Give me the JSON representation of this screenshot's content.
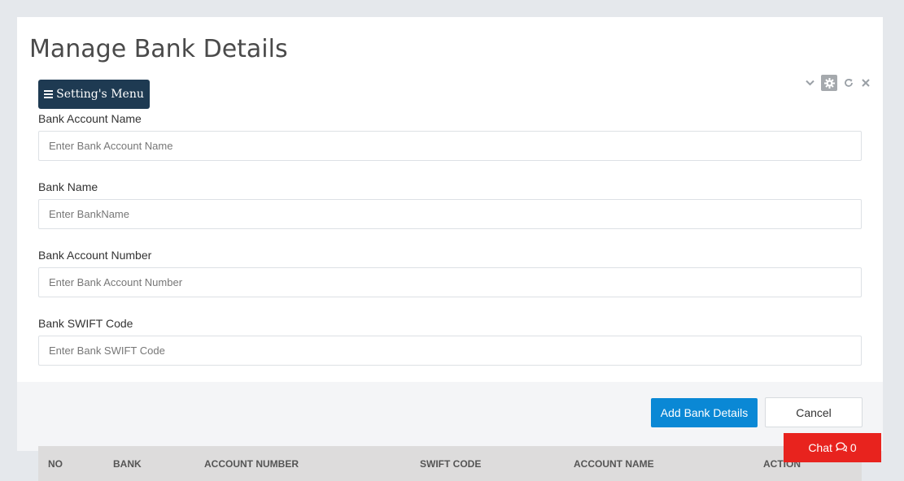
{
  "page": {
    "title": "Manage Bank Details"
  },
  "toolbar": {
    "menu_label": "Setting's Menu",
    "icons": [
      "chevron-down-icon",
      "gear-icon",
      "refresh-icon",
      "close-icon"
    ]
  },
  "form": {
    "fields": [
      {
        "label": "Bank Account Name",
        "placeholder": "Enter Bank Account Name",
        "value": ""
      },
      {
        "label": "Bank Name",
        "placeholder": "Enter BankName",
        "value": ""
      },
      {
        "label": "Bank Account Number",
        "placeholder": "Enter Bank Account Number",
        "value": ""
      },
      {
        "label": "Bank SWIFT Code",
        "placeholder": "Enter Bank SWIFT Code",
        "value": ""
      }
    ],
    "submit_label": "Add Bank Details",
    "cancel_label": "Cancel"
  },
  "table": {
    "columns": [
      "NO",
      "BANK",
      "ACCOUNT NUMBER",
      "SWIFT CODE",
      "ACCOUNT NAME",
      "ACTION"
    ]
  },
  "chat": {
    "label": "Chat",
    "count": "0",
    "icon": "comments-icon"
  },
  "colors": {
    "menu_button": "#1e3a52",
    "primary_button": "#0a88d5",
    "chat_button": "#e8231e",
    "table_header": "#dddcdc"
  }
}
